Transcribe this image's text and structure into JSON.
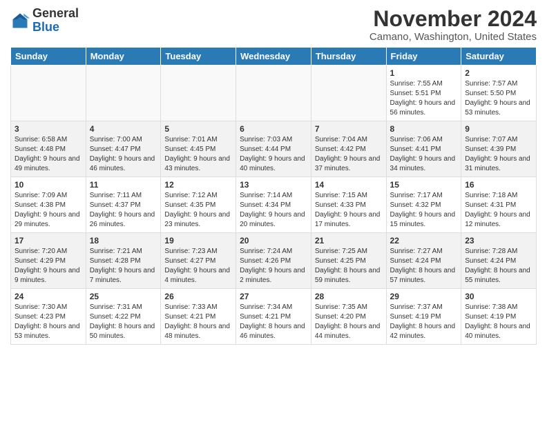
{
  "logo": {
    "general": "General",
    "blue": "Blue"
  },
  "title": "November 2024",
  "location": "Camano, Washington, United States",
  "days_of_week": [
    "Sunday",
    "Monday",
    "Tuesday",
    "Wednesday",
    "Thursday",
    "Friday",
    "Saturday"
  ],
  "weeks": [
    [
      {
        "day": "",
        "info": ""
      },
      {
        "day": "",
        "info": ""
      },
      {
        "day": "",
        "info": ""
      },
      {
        "day": "",
        "info": ""
      },
      {
        "day": "",
        "info": ""
      },
      {
        "day": "1",
        "info": "Sunrise: 7:55 AM\nSunset: 5:51 PM\nDaylight: 9 hours and 56 minutes."
      },
      {
        "day": "2",
        "info": "Sunrise: 7:57 AM\nSunset: 5:50 PM\nDaylight: 9 hours and 53 minutes."
      }
    ],
    [
      {
        "day": "3",
        "info": "Sunrise: 6:58 AM\nSunset: 4:48 PM\nDaylight: 9 hours and 49 minutes."
      },
      {
        "day": "4",
        "info": "Sunrise: 7:00 AM\nSunset: 4:47 PM\nDaylight: 9 hours and 46 minutes."
      },
      {
        "day": "5",
        "info": "Sunrise: 7:01 AM\nSunset: 4:45 PM\nDaylight: 9 hours and 43 minutes."
      },
      {
        "day": "6",
        "info": "Sunrise: 7:03 AM\nSunset: 4:44 PM\nDaylight: 9 hours and 40 minutes."
      },
      {
        "day": "7",
        "info": "Sunrise: 7:04 AM\nSunset: 4:42 PM\nDaylight: 9 hours and 37 minutes."
      },
      {
        "day": "8",
        "info": "Sunrise: 7:06 AM\nSunset: 4:41 PM\nDaylight: 9 hours and 34 minutes."
      },
      {
        "day": "9",
        "info": "Sunrise: 7:07 AM\nSunset: 4:39 PM\nDaylight: 9 hours and 31 minutes."
      }
    ],
    [
      {
        "day": "10",
        "info": "Sunrise: 7:09 AM\nSunset: 4:38 PM\nDaylight: 9 hours and 29 minutes."
      },
      {
        "day": "11",
        "info": "Sunrise: 7:11 AM\nSunset: 4:37 PM\nDaylight: 9 hours and 26 minutes."
      },
      {
        "day": "12",
        "info": "Sunrise: 7:12 AM\nSunset: 4:35 PM\nDaylight: 9 hours and 23 minutes."
      },
      {
        "day": "13",
        "info": "Sunrise: 7:14 AM\nSunset: 4:34 PM\nDaylight: 9 hours and 20 minutes."
      },
      {
        "day": "14",
        "info": "Sunrise: 7:15 AM\nSunset: 4:33 PM\nDaylight: 9 hours and 17 minutes."
      },
      {
        "day": "15",
        "info": "Sunrise: 7:17 AM\nSunset: 4:32 PM\nDaylight: 9 hours and 15 minutes."
      },
      {
        "day": "16",
        "info": "Sunrise: 7:18 AM\nSunset: 4:31 PM\nDaylight: 9 hours and 12 minutes."
      }
    ],
    [
      {
        "day": "17",
        "info": "Sunrise: 7:20 AM\nSunset: 4:29 PM\nDaylight: 9 hours and 9 minutes."
      },
      {
        "day": "18",
        "info": "Sunrise: 7:21 AM\nSunset: 4:28 PM\nDaylight: 9 hours and 7 minutes."
      },
      {
        "day": "19",
        "info": "Sunrise: 7:23 AM\nSunset: 4:27 PM\nDaylight: 9 hours and 4 minutes."
      },
      {
        "day": "20",
        "info": "Sunrise: 7:24 AM\nSunset: 4:26 PM\nDaylight: 9 hours and 2 minutes."
      },
      {
        "day": "21",
        "info": "Sunrise: 7:25 AM\nSunset: 4:25 PM\nDaylight: 8 hours and 59 minutes."
      },
      {
        "day": "22",
        "info": "Sunrise: 7:27 AM\nSunset: 4:24 PM\nDaylight: 8 hours and 57 minutes."
      },
      {
        "day": "23",
        "info": "Sunrise: 7:28 AM\nSunset: 4:24 PM\nDaylight: 8 hours and 55 minutes."
      }
    ],
    [
      {
        "day": "24",
        "info": "Sunrise: 7:30 AM\nSunset: 4:23 PM\nDaylight: 8 hours and 53 minutes."
      },
      {
        "day": "25",
        "info": "Sunrise: 7:31 AM\nSunset: 4:22 PM\nDaylight: 8 hours and 50 minutes."
      },
      {
        "day": "26",
        "info": "Sunrise: 7:33 AM\nSunset: 4:21 PM\nDaylight: 8 hours and 48 minutes."
      },
      {
        "day": "27",
        "info": "Sunrise: 7:34 AM\nSunset: 4:21 PM\nDaylight: 8 hours and 46 minutes."
      },
      {
        "day": "28",
        "info": "Sunrise: 7:35 AM\nSunset: 4:20 PM\nDaylight: 8 hours and 44 minutes."
      },
      {
        "day": "29",
        "info": "Sunrise: 7:37 AM\nSunset: 4:19 PM\nDaylight: 8 hours and 42 minutes."
      },
      {
        "day": "30",
        "info": "Sunrise: 7:38 AM\nSunset: 4:19 PM\nDaylight: 8 hours and 40 minutes."
      }
    ]
  ]
}
